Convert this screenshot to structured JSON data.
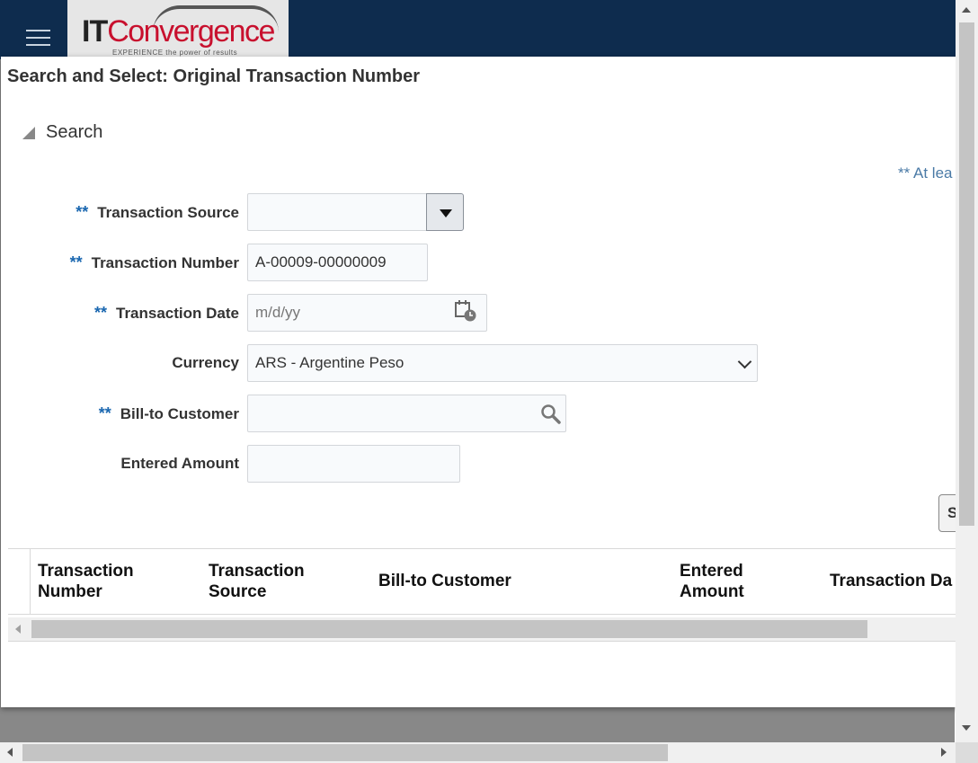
{
  "header": {
    "menu_icon": "hamburger-icon",
    "logo": {
      "text_it": "IT",
      "text_conv": "Convergence",
      "tagline": "EXPERIENCE the power of results"
    }
  },
  "dialog": {
    "title": "Search and Select: Original Transaction Number",
    "search_section": {
      "label": "Search",
      "collapse_icon": "disclosure-triangle-icon"
    },
    "required_note": "** At lea",
    "fields": {
      "transaction_source": {
        "marker": "**",
        "label": "Transaction Source",
        "value": "",
        "button_icon": "dropdown-arrow-icon"
      },
      "transaction_number": {
        "marker": "**",
        "label": "Transaction Number",
        "value": "A-00009-00000009"
      },
      "transaction_date": {
        "marker": "**",
        "label": "Transaction Date",
        "placeholder": "m/d/yy",
        "button_icon": "calendar-icon"
      },
      "currency": {
        "label": "Currency",
        "value": "ARS - Argentine Peso",
        "button_icon": "chevron-down-icon"
      },
      "bill_to_customer": {
        "marker": "**",
        "label": "Bill-to Customer",
        "value": "",
        "button_icon": "search-icon"
      },
      "entered_amount": {
        "label": "Entered Amount",
        "value": ""
      }
    },
    "search_button": "S",
    "table": {
      "columns": [
        {
          "line1": "Transaction",
          "line2": "Number"
        },
        {
          "line1": "Transaction",
          "line2": "Source"
        },
        {
          "line1": "Bill-to Customer",
          "line2": ""
        },
        {
          "line1": "Entered",
          "line2": "Amount"
        },
        {
          "line1": "Transaction Da",
          "line2": ""
        }
      ],
      "rows": []
    }
  }
}
